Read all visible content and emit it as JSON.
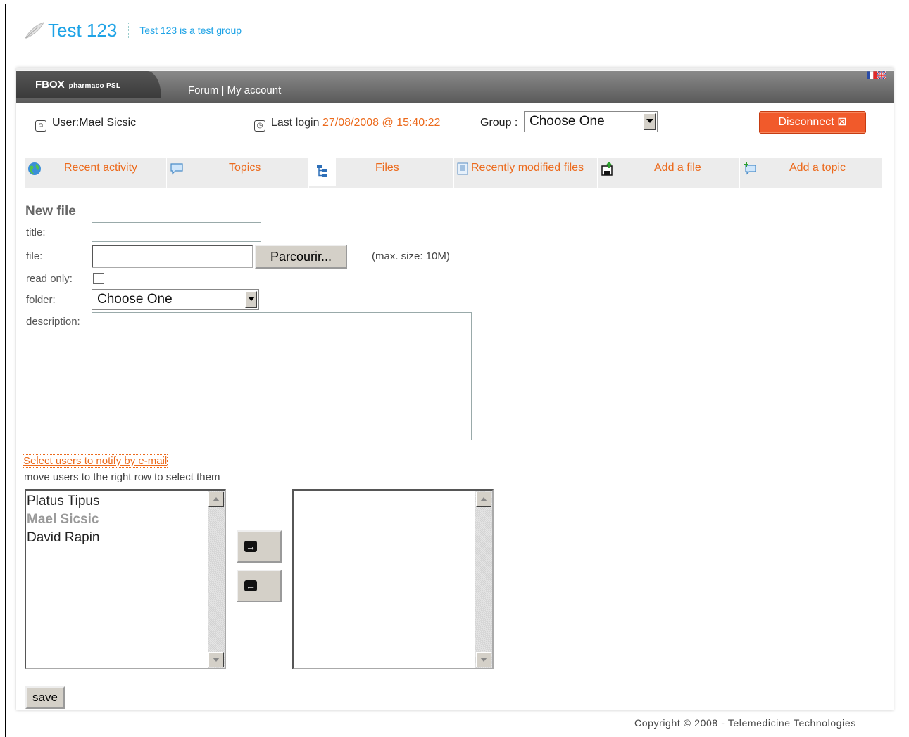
{
  "group": {
    "title": "Test 123",
    "subtitle": "Test 123 is a test group"
  },
  "topbar": {
    "brand": "FBOX",
    "brand_sub": "pharmaco PSL",
    "nav": "Forum | My account"
  },
  "user": {
    "label": "User:Mael Sicsic",
    "last_login_label": "Last login",
    "last_login_value": "27/08/2008 @ 15:40:22",
    "group_label": "Group :",
    "group_select": "Choose One",
    "disconnect": "Disconnect ⊠"
  },
  "tabs": [
    "Recent activity",
    "Topics",
    "Files",
    "Recently modified files",
    "Add a file",
    "Add a topic"
  ],
  "form": {
    "heading": "New file",
    "title_label": "title:",
    "file_label": "file:",
    "browse": "Parcourir...",
    "max_size": "(max. size: 10M)",
    "readonly_label": "read only:",
    "folder_label": "folder:",
    "folder_select": "Choose One",
    "description_label": "description:"
  },
  "notify": {
    "link": "Select users to notify by e-mail",
    "hint": "move users to the right row to select them",
    "available_users": [
      "Platus Tipus",
      "Mael Sicsic",
      "David Rapin"
    ],
    "selected_users": []
  },
  "save": "save",
  "copyright": "Copyright © 2008 - Telemedicine Technologies"
}
